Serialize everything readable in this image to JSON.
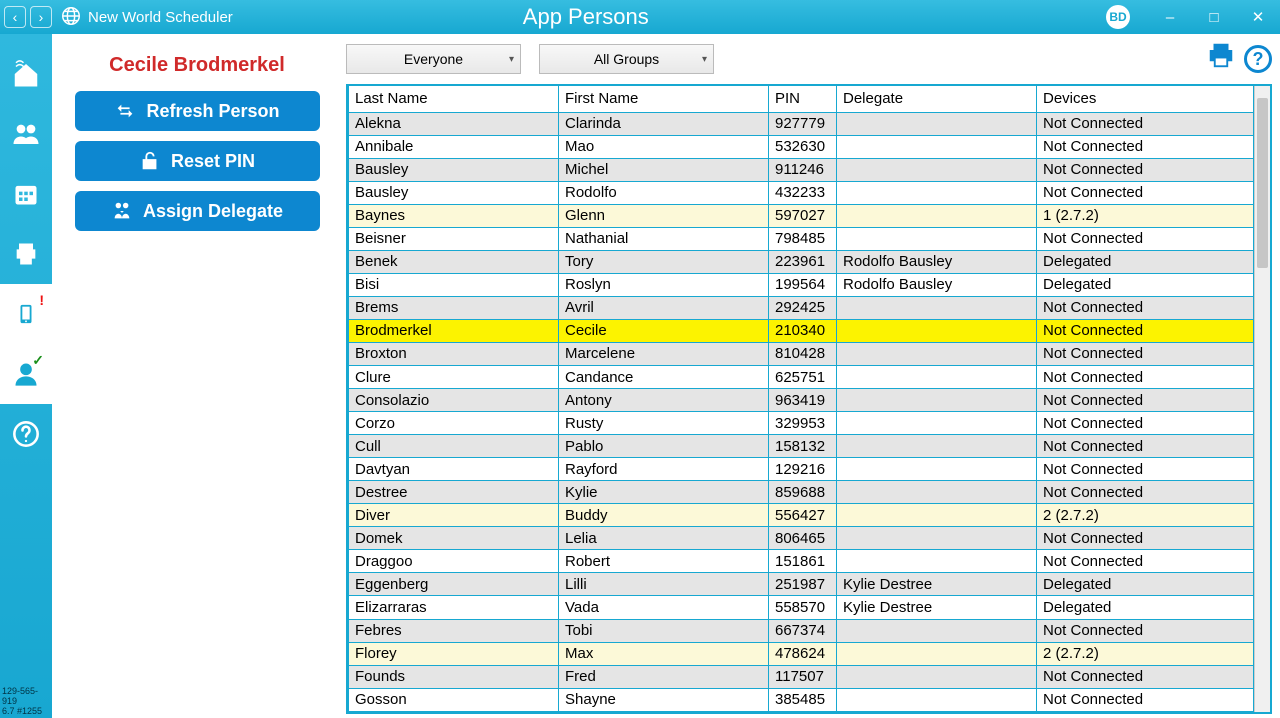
{
  "header": {
    "app_name": "New World Scheduler",
    "page_title": "App Persons",
    "badge": "BD"
  },
  "sidebar": {
    "footer_line1": "129-565-919",
    "footer_line2": "6.7 #1255"
  },
  "panel": {
    "selected_person": "Cecile Brodmerkel",
    "refresh_label": "Refresh Person",
    "reset_label": "Reset PIN",
    "assign_label": "Assign Delegate"
  },
  "toolbar": {
    "filter1": "Everyone",
    "filter2": "All Groups"
  },
  "grid": {
    "columns": [
      "Last Name",
      "First Name",
      "PIN",
      "Delegate",
      "Devices"
    ],
    "rows": [
      {
        "last": "Alekna",
        "first": "Clarinda",
        "pin": "927779",
        "del": "",
        "dev": "Not Connected",
        "hl": ""
      },
      {
        "last": "Annibale",
        "first": "Mao",
        "pin": "532630",
        "del": "",
        "dev": "Not Connected",
        "hl": ""
      },
      {
        "last": "Bausley",
        "first": "Michel",
        "pin": "911246",
        "del": "",
        "dev": "Not Connected",
        "hl": ""
      },
      {
        "last": "Bausley",
        "first": "Rodolfo",
        "pin": "432233",
        "del": "",
        "dev": "Not Connected",
        "hl": ""
      },
      {
        "last": "Baynes",
        "first": "Glenn",
        "pin": "597027",
        "del": "",
        "dev": "1 (2.7.2)",
        "hl": "yellow"
      },
      {
        "last": "Beisner",
        "first": "Nathanial",
        "pin": "798485",
        "del": "",
        "dev": "Not Connected",
        "hl": ""
      },
      {
        "last": "Benek",
        "first": "Tory",
        "pin": "223961",
        "del": "Rodolfo Bausley",
        "dev": "Delegated",
        "hl": ""
      },
      {
        "last": "Bisi",
        "first": "Roslyn",
        "pin": "199564",
        "del": "Rodolfo Bausley",
        "dev": "Delegated",
        "hl": ""
      },
      {
        "last": "Brems",
        "first": "Avril",
        "pin": "292425",
        "del": "",
        "dev": "Not Connected",
        "hl": ""
      },
      {
        "last": "Brodmerkel",
        "first": "Cecile",
        "pin": "210340",
        "del": "",
        "dev": "Not Connected",
        "hl": "sel"
      },
      {
        "last": "Broxton",
        "first": "Marcelene",
        "pin": "810428",
        "del": "",
        "dev": "Not Connected",
        "hl": ""
      },
      {
        "last": "Clure",
        "first": "Candance",
        "pin": "625751",
        "del": "",
        "dev": "Not Connected",
        "hl": ""
      },
      {
        "last": "Consolazio",
        "first": "Antony",
        "pin": "963419",
        "del": "",
        "dev": "Not Connected",
        "hl": ""
      },
      {
        "last": "Corzo",
        "first": "Rusty",
        "pin": "329953",
        "del": "",
        "dev": "Not Connected",
        "hl": ""
      },
      {
        "last": "Cull",
        "first": "Pablo",
        "pin": "158132",
        "del": "",
        "dev": "Not Connected",
        "hl": ""
      },
      {
        "last": "Davtyan",
        "first": "Rayford",
        "pin": "129216",
        "del": "",
        "dev": "Not Connected",
        "hl": ""
      },
      {
        "last": "Destree",
        "first": "Kylie",
        "pin": "859688",
        "del": "",
        "dev": "Not Connected",
        "hl": ""
      },
      {
        "last": "Diver",
        "first": "Buddy",
        "pin": "556427",
        "del": "",
        "dev": "2 (2.7.2)",
        "hl": "yellow"
      },
      {
        "last": "Domek",
        "first": "Lelia",
        "pin": "806465",
        "del": "",
        "dev": "Not Connected",
        "hl": ""
      },
      {
        "last": "Draggoo",
        "first": "Robert",
        "pin": "151861",
        "del": "",
        "dev": "Not Connected",
        "hl": ""
      },
      {
        "last": "Eggenberg",
        "first": "Lilli",
        "pin": "251987",
        "del": "Kylie Destree",
        "dev": "Delegated",
        "hl": ""
      },
      {
        "last": "Elizarraras",
        "first": "Vada",
        "pin": "558570",
        "del": "Kylie Destree",
        "dev": "Delegated",
        "hl": ""
      },
      {
        "last": "Febres",
        "first": "Tobi",
        "pin": "667374",
        "del": "",
        "dev": "Not Connected",
        "hl": ""
      },
      {
        "last": "Florey",
        "first": "Max",
        "pin": "478624",
        "del": "",
        "dev": "2 (2.7.2)",
        "hl": "yellow"
      },
      {
        "last": "Founds",
        "first": "Fred",
        "pin": "117507",
        "del": "",
        "dev": "Not Connected",
        "hl": ""
      },
      {
        "last": "Gosson",
        "first": "Shayne",
        "pin": "385485",
        "del": "",
        "dev": "Not Connected",
        "hl": ""
      }
    ]
  }
}
